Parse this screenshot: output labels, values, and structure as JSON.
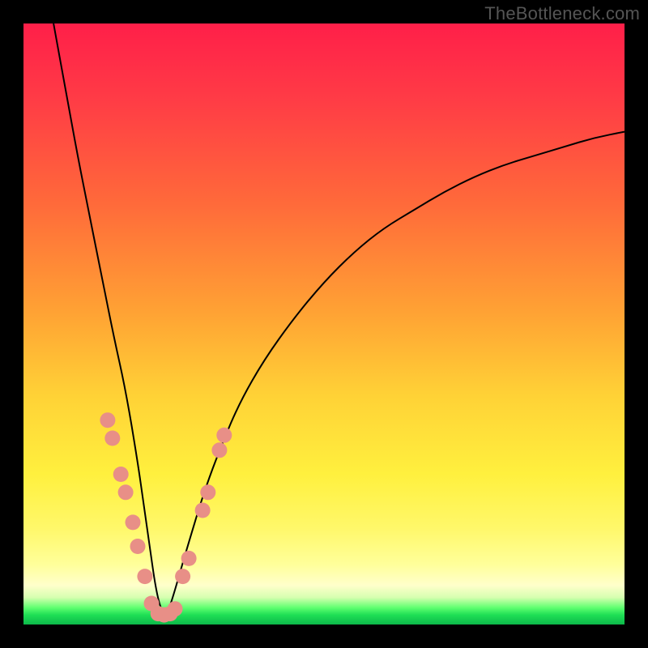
{
  "watermark": "TheBottleneck.com",
  "chart_data": {
    "type": "line",
    "title": "",
    "xlabel": "",
    "ylabel": "",
    "xlim": [
      0,
      100
    ],
    "ylim": [
      0,
      100
    ],
    "notes": "No axis ticks or labels visible. Values are estimated from pixel positions on a 0–100 scale corresponding to the visible plot area (origin bottom-left). The y-axis appears to represent a bottleneck/mismatch percentage (lower is better). The colored background encodes goodness: red≈bad, yellow≈moderate, green≈ideal. A V-shaped curve dips to near 0 around x≈23. Salmon dots lie on both arms of the V in the lower region.",
    "series": [
      {
        "name": "curve",
        "x": [
          5,
          7,
          9,
          11,
          13,
          15,
          17,
          19,
          20,
          21,
          22,
          23,
          24,
          25,
          27,
          30,
          33,
          36,
          40,
          45,
          50,
          55,
          60,
          65,
          70,
          75,
          80,
          85,
          90,
          95,
          100
        ],
        "y": [
          100,
          89,
          78,
          68,
          58,
          48,
          39,
          27,
          20,
          13,
          6,
          2,
          2,
          5,
          12,
          22,
          30,
          37,
          44,
          51,
          57,
          62,
          66,
          69,
          72,
          74.5,
          76.5,
          78,
          79.5,
          81,
          82
        ]
      }
    ],
    "points": [
      {
        "name": "dots-left-arm",
        "x": [
          14.0,
          14.8,
          16.2,
          17.0,
          18.2,
          19.0,
          20.2,
          21.3
        ],
        "y": [
          34.0,
          31.0,
          25.0,
          22.0,
          17.0,
          13.0,
          8.0,
          3.5
        ]
      },
      {
        "name": "dots-bottom",
        "x": [
          22.4,
          23.4,
          24.4,
          25.2
        ],
        "y": [
          1.8,
          1.6,
          1.8,
          2.6
        ]
      },
      {
        "name": "dots-right-arm",
        "x": [
          26.5,
          27.5,
          29.8,
          30.7,
          32.6,
          33.4
        ],
        "y": [
          8.0,
          11.0,
          19.0,
          22.0,
          29.0,
          31.5
        ]
      }
    ],
    "background_bands": [
      {
        "name": "red",
        "y_from": 60,
        "y_to": 100,
        "color": "#ff2a45"
      },
      {
        "name": "orange",
        "y_from": 35,
        "y_to": 60,
        "color": "#ff8f36"
      },
      {
        "name": "yellow",
        "y_from": 8,
        "y_to": 35,
        "color": "#fff04a"
      },
      {
        "name": "pale",
        "y_from": 4,
        "y_to": 8,
        "color": "#ffffc0"
      },
      {
        "name": "green",
        "y_from": 0,
        "y_to": 4,
        "color": "#1fc255"
      }
    ]
  }
}
